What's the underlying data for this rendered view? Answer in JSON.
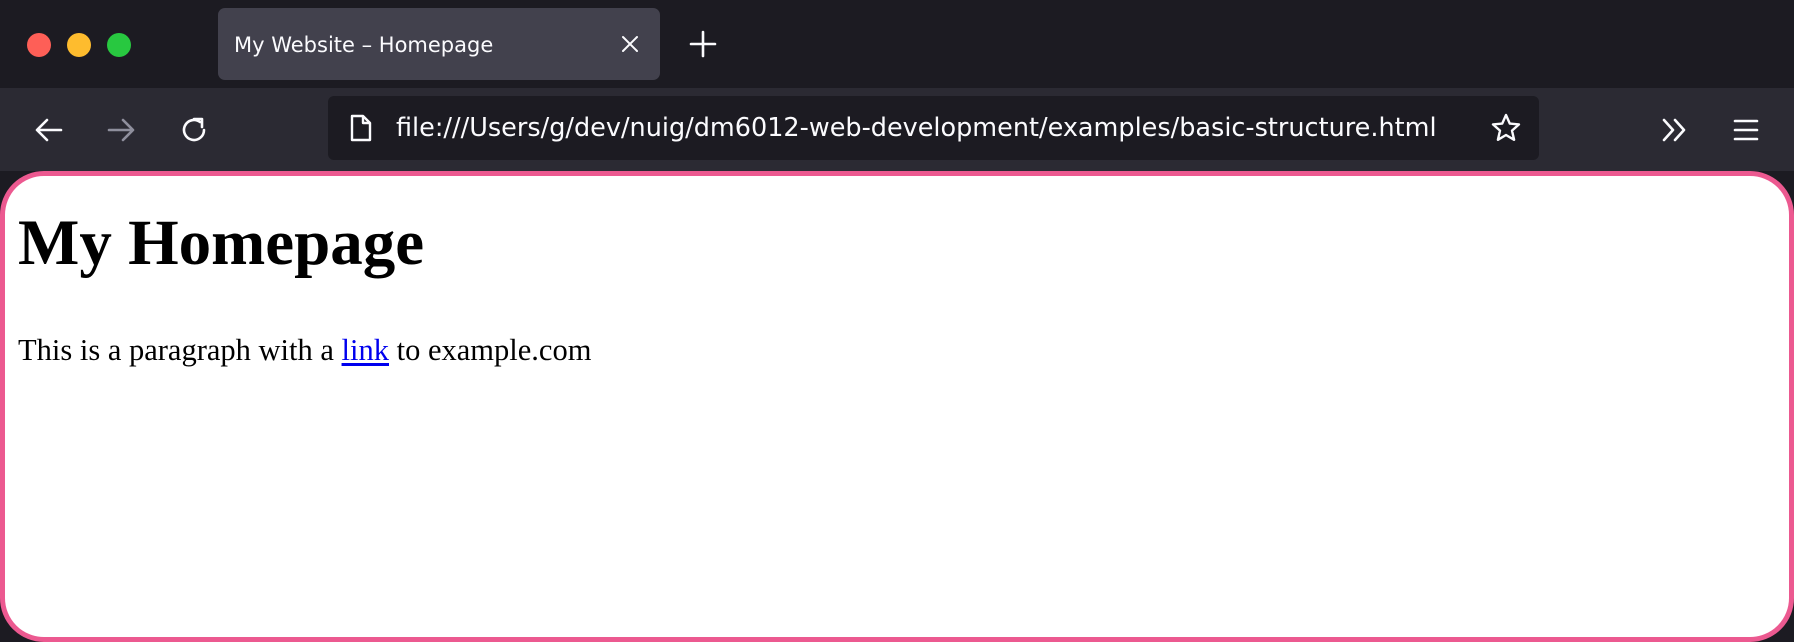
{
  "window": {
    "controls": [
      "close",
      "minimize",
      "zoom"
    ]
  },
  "tabs": [
    {
      "title": "My Website – Homepage",
      "active": true
    }
  ],
  "toolbar": {
    "icons": [
      "back-arrow-icon",
      "forward-arrow-icon",
      "reload-icon",
      "page-icon",
      "bookmark-star-icon",
      "overflow-chevrons-icon",
      "hamburger-menu-icon"
    ],
    "forward_enabled": false
  },
  "urlbar": {
    "url": "file:///Users/g/dev/nuig/dm6012-web-development/examples/basic-structure.html"
  },
  "page": {
    "heading": "My Homepage",
    "paragraph_before": "This is a paragraph with a ",
    "link_text": "link",
    "paragraph_after": " to example.com"
  },
  "colors": {
    "chrome_dark": "#1c1b22",
    "toolbar": "#2b2a33",
    "active_tab": "#42414d",
    "highlight_border": "#ec5990",
    "link": "#0000ee"
  }
}
